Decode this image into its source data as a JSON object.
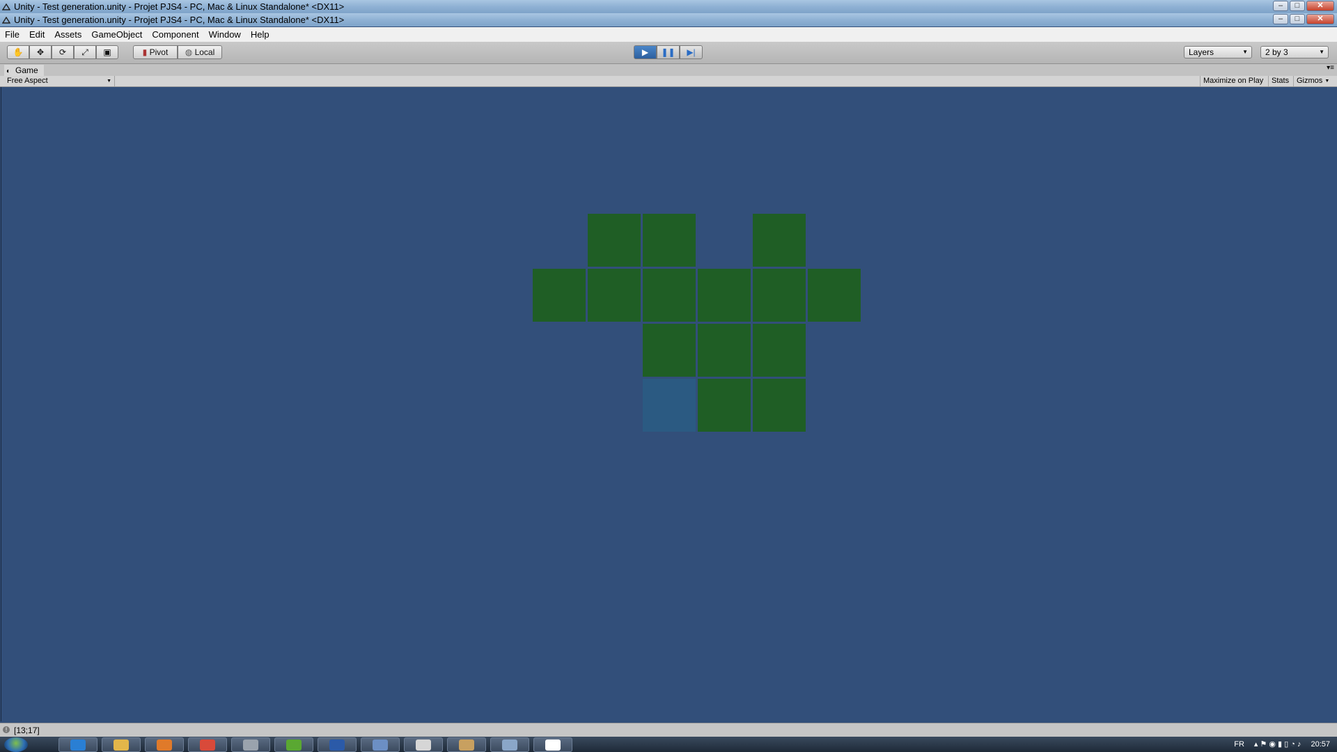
{
  "window": {
    "title_1": "Unity - Test generation.unity - Projet PJS4 - PC, Mac & Linux Standalone* <DX11>",
    "title_2": "Unity - Test generation.unity - Projet PJS4 - PC, Mac & Linux Standalone* <DX11>",
    "minimize": "–",
    "maximize": "□",
    "close": "✕"
  },
  "menu": [
    "File",
    "Edit",
    "Assets",
    "GameObject",
    "Component",
    "Window",
    "Help"
  ],
  "toolbar": {
    "tools": [
      "hand-icon",
      "move-icon",
      "rotate-icon",
      "scale-icon",
      "rect-icon"
    ],
    "tool_glyphs": [
      "✋",
      "✥",
      "⟳",
      "⤢",
      "▣"
    ],
    "pivot_label": "Pivot",
    "local_label": "Local",
    "play_glyph": "▶",
    "pause_glyph": "❚❚",
    "step_glyph": "▶|",
    "layers_label": "Layers",
    "layout_label": "2 by 3"
  },
  "game_tab": {
    "label": "Game",
    "aspect": "Free Aspect",
    "maximize_on_play": "Maximize on Play",
    "stats": "Stats",
    "gizmos": "Gizmos"
  },
  "grid": {
    "columns": 6,
    "rows": 4,
    "cells": [
      [
        0,
        1,
        1,
        0,
        1,
        0
      ],
      [
        1,
        1,
        1,
        1,
        1,
        1
      ],
      [
        0,
        0,
        1,
        1,
        1,
        0
      ],
      [
        0,
        0,
        2,
        1,
        1,
        0
      ]
    ],
    "legend_note": "1 = green tile, 2 = highlighted empty tile, 0 = no tile",
    "colors": {
      "tile": "#1f5e25",
      "highlight": "#2b5a82",
      "background": "#324f7a"
    }
  },
  "status": {
    "message": "[13;17]"
  },
  "taskbar": {
    "language": "FR",
    "time": "20:57",
    "apps": [
      "ie-icon",
      "explorer-icon",
      "media-player-icon",
      "chrome-icon",
      "disc-icon",
      "utorrent-icon",
      "word-icon",
      "itunes-icon",
      "chart-app-icon",
      "paint-icon",
      "settings-app-icon",
      "unity-icon"
    ]
  }
}
